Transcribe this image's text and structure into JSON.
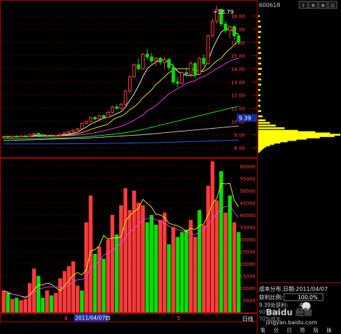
{
  "header": {
    "code": "600618"
  },
  "toolbar": [
    "⇧",
    "⊕",
    "⊗",
    "⊡"
  ],
  "price_axis": {
    "ticks": [
      "18.00",
      "17.00",
      "16.00",
      "15.00",
      "14.00",
      "13.00",
      "12.00",
      "11.00",
      "10.00",
      "9.00",
      "8.00"
    ],
    "current_price": "9.39",
    "high_label": "18.79"
  },
  "volume_axis": {
    "ticks": [
      "60000",
      "55000",
      "50000",
      "45000",
      "40000",
      "35000",
      "30000",
      "25000",
      "20000",
      "15000",
      "10000",
      "5000"
    ]
  },
  "date_axis": {
    "month_a": "4",
    "date_label": "2011/04/07四",
    "month_b": "5",
    "period": "日线"
  },
  "chip_panel": {
    "title": "成本分布,日期:",
    "date": "2011/04/07",
    "profit_label": "获利比例:",
    "profit_value": "100.0%",
    "line3": "9.39处获利:",
    "line3_value": "41%",
    "line4": "90%成本",
    "line5": "70%成本"
  },
  "bottom_tabs": [
    "笔",
    "分",
    "日",
    "势",
    "指",
    "操"
  ],
  "watermark": "Baidu 经验",
  "watermark_url": "jingyan.baidu.com",
  "colors": {
    "up": "#ff3b3b",
    "down": "#00e000",
    "ma5": "#ffffff",
    "ma10": "#ffff00",
    "ma20": "#ff40ff",
    "ma60": "#00ff00",
    "ma120": "#d0d0d0",
    "ma250": "#3060ff",
    "chips": "#ffff00",
    "grid": "#a00000"
  },
  "chart_data": {
    "type": "candlestick+volume",
    "candles": [
      [
        8.8,
        8.9,
        8.7,
        8.85
      ],
      [
        8.85,
        8.95,
        8.75,
        8.8
      ],
      [
        8.8,
        8.9,
        8.7,
        8.88
      ],
      [
        8.88,
        8.95,
        8.78,
        8.82
      ],
      [
        8.82,
        8.95,
        8.8,
        8.9
      ],
      [
        8.9,
        9.0,
        8.8,
        8.85
      ],
      [
        8.85,
        9.05,
        8.85,
        9.0
      ],
      [
        9.0,
        9.15,
        8.95,
        9.1
      ],
      [
        9.1,
        9.15,
        8.95,
        9.0
      ],
      [
        9.0,
        9.05,
        8.85,
        8.9
      ],
      [
        8.9,
        9.0,
        8.8,
        8.95
      ],
      [
        8.95,
        9.05,
        8.85,
        8.88
      ],
      [
        8.88,
        9.0,
        8.8,
        8.95
      ],
      [
        8.95,
        9.1,
        8.9,
        9.05
      ],
      [
        9.05,
        9.2,
        9.0,
        9.15
      ],
      [
        9.15,
        9.3,
        9.1,
        9.25
      ],
      [
        9.25,
        9.4,
        9.2,
        9.35
      ],
      [
        9.35,
        9.5,
        9.3,
        9.45
      ],
      [
        9.45,
        9.9,
        9.4,
        9.85
      ],
      [
        9.85,
        10.1,
        9.8,
        10.0
      ],
      [
        10.0,
        10.4,
        9.95,
        10.3
      ],
      [
        10.3,
        10.4,
        10.1,
        10.2
      ],
      [
        10.2,
        10.5,
        10.1,
        10.45
      ],
      [
        10.45,
        10.5,
        10.2,
        10.3
      ],
      [
        10.3,
        10.8,
        10.25,
        10.7
      ],
      [
        10.7,
        11.2,
        10.6,
        11.1
      ],
      [
        11.1,
        11.3,
        10.9,
        11.0
      ],
      [
        11.0,
        11.4,
        10.9,
        11.3
      ],
      [
        11.3,
        12.4,
        11.2,
        12.3
      ],
      [
        12.3,
        13.5,
        12.2,
        13.4
      ],
      [
        13.4,
        14.4,
        13.3,
        14.3
      ],
      [
        14.3,
        14.8,
        13.9,
        14.0
      ],
      [
        14.0,
        15.2,
        13.9,
        15.1
      ],
      [
        15.1,
        15.5,
        14.7,
        14.9
      ],
      [
        14.9,
        15.2,
        14.4,
        14.6
      ],
      [
        14.6,
        14.9,
        14.2,
        14.8
      ],
      [
        14.8,
        14.9,
        14.3,
        14.5
      ],
      [
        14.5,
        14.9,
        14.0,
        14.7
      ],
      [
        14.7,
        14.8,
        13.9,
        14.1
      ],
      [
        14.1,
        14.4,
        12.8,
        13.0
      ],
      [
        13.0,
        13.4,
        12.6,
        12.9
      ],
      [
        12.9,
        13.8,
        12.8,
        13.7
      ],
      [
        13.7,
        14.1,
        13.4,
        13.6
      ],
      [
        13.6,
        14.6,
        13.3,
        14.4
      ],
      [
        14.4,
        14.5,
        13.3,
        13.6
      ],
      [
        13.6,
        14.9,
        13.5,
        14.8
      ],
      [
        14.8,
        15.1,
        14.2,
        14.4
      ],
      [
        14.4,
        16.6,
        14.3,
        16.5
      ],
      [
        16.5,
        17.8,
        16.4,
        17.6
      ],
      [
        17.6,
        18.79,
        17.4,
        18.5
      ],
      [
        18.5,
        18.6,
        17.2,
        17.4
      ],
      [
        17.4,
        17.6,
        16.7,
        16.9
      ],
      [
        16.9,
        17.3,
        16.3,
        17.2
      ],
      [
        17.2,
        17.3,
        16.2,
        16.5
      ],
      [
        16.5,
        16.6,
        15.8,
        16.0
      ]
    ],
    "volume": [
      [
        9000,
        "up"
      ],
      [
        8000,
        "down"
      ],
      [
        5500,
        "up"
      ],
      [
        6000,
        "down"
      ],
      [
        5000,
        "up"
      ],
      [
        5500,
        "up"
      ],
      [
        12000,
        "up"
      ],
      [
        18000,
        "up"
      ],
      [
        15000,
        "down"
      ],
      [
        6000,
        "down"
      ],
      [
        9000,
        "up"
      ],
      [
        7000,
        "down"
      ],
      [
        8000,
        "up"
      ],
      [
        14000,
        "up"
      ],
      [
        17000,
        "up"
      ],
      [
        19000,
        "up"
      ],
      [
        21000,
        "up"
      ],
      [
        11000,
        "up"
      ],
      [
        9000,
        "down"
      ],
      [
        37000,
        "up"
      ],
      [
        48000,
        "up"
      ],
      [
        24000,
        "down"
      ],
      [
        27000,
        "up"
      ],
      [
        22000,
        "down"
      ],
      [
        30000,
        "up"
      ],
      [
        40000,
        "up"
      ],
      [
        32000,
        "down"
      ],
      [
        44000,
        "up"
      ],
      [
        51000,
        "up"
      ],
      [
        42000,
        "up"
      ],
      [
        50000,
        "up"
      ],
      [
        45000,
        "up"
      ],
      [
        44000,
        "up"
      ],
      [
        37000,
        "down"
      ],
      [
        40000,
        "down"
      ],
      [
        36000,
        "down"
      ],
      [
        38000,
        "up"
      ],
      [
        41000,
        "up"
      ],
      [
        28000,
        "down"
      ],
      [
        35000,
        "up"
      ],
      [
        31000,
        "down"
      ],
      [
        33000,
        "down"
      ],
      [
        34000,
        "down"
      ],
      [
        38000,
        "up"
      ],
      [
        31000,
        "up"
      ],
      [
        42000,
        "down"
      ],
      [
        36000,
        "up"
      ],
      [
        52000,
        "up"
      ],
      [
        62000,
        "up"
      ],
      [
        46000,
        "up"
      ],
      [
        58000,
        "down"
      ],
      [
        41000,
        "up"
      ],
      [
        48000,
        "down"
      ],
      [
        37000,
        "up"
      ],
      [
        33000,
        "down"
      ]
    ],
    "ma_price": {
      "ma5": [
        8.85,
        8.84,
        8.85,
        8.86,
        8.86,
        8.85,
        8.87,
        8.93,
        8.98,
        8.97,
        8.95,
        8.94,
        8.93,
        8.96,
        8.99,
        9.05,
        9.13,
        9.2,
        9.39,
        9.58,
        9.8,
        9.96,
        10.1,
        10.25,
        10.32,
        10.45,
        10.6,
        10.75,
        11.1,
        11.6,
        12.1,
        12.7,
        13.4,
        14.0,
        14.3,
        14.5,
        14.7,
        14.6,
        14.5,
        14.2,
        13.8,
        13.6,
        13.5,
        13.5,
        13.5,
        13.6,
        14.0,
        14.6,
        15.5,
        16.2,
        16.8,
        17.0,
        17.0,
        16.8,
        16.6
      ],
      "ma10": [
        8.86,
        8.86,
        8.86,
        8.86,
        8.86,
        8.86,
        8.86,
        8.88,
        8.9,
        8.92,
        8.92,
        8.92,
        8.92,
        8.93,
        8.95,
        8.98,
        9.03,
        9.08,
        9.17,
        9.27,
        9.4,
        9.5,
        9.6,
        9.7,
        9.8,
        10.1,
        10.3,
        10.4,
        10.6,
        10.9,
        11.1,
        11.4,
        11.8,
        12.1,
        12.4,
        12.8,
        13.1,
        13.4,
        13.7,
        13.9,
        14.0,
        14.0,
        14.0,
        14.0,
        13.9,
        13.8,
        13.8,
        14.0,
        14.3,
        14.6,
        14.8,
        15.2,
        15.5,
        15.8,
        16.1
      ],
      "ma20": [
        8.86,
        8.86,
        8.86,
        8.86,
        8.86,
        8.86,
        8.86,
        8.86,
        8.86,
        8.86,
        8.87,
        8.88,
        8.89,
        8.9,
        8.92,
        8.93,
        8.95,
        8.97,
        9.0,
        9.05,
        9.1,
        9.15,
        9.22,
        9.3,
        9.38,
        9.46,
        9.55,
        9.65,
        9.78,
        9.93,
        10.1,
        10.3,
        10.5,
        10.8,
        11.0,
        11.2,
        11.5,
        11.8,
        12.1,
        12.3,
        12.5,
        12.7,
        12.9,
        13.0,
        13.1,
        13.3,
        13.4,
        13.6,
        13.8,
        14.0,
        14.2,
        14.4,
        14.6,
        14.7,
        14.8
      ],
      "ma60": [
        8.7,
        8.7,
        8.7,
        8.7,
        8.7,
        8.7,
        8.71,
        8.71,
        8.72,
        8.72,
        8.73,
        8.73,
        8.74,
        8.75,
        8.76,
        8.77,
        8.78,
        8.8,
        8.82,
        8.84,
        8.87,
        8.9,
        8.93,
        8.96,
        9.0,
        9.03,
        9.07,
        9.11,
        9.16,
        9.21,
        9.27,
        9.33,
        9.4,
        9.48,
        9.56,
        9.64,
        9.72,
        9.8,
        9.88,
        9.96,
        10.04,
        10.12,
        10.2,
        10.28,
        10.36,
        10.44,
        10.52,
        10.6,
        10.68,
        10.76,
        10.84,
        10.92,
        11.0,
        11.08,
        11.16
      ],
      "ma120": [
        8.55,
        8.56,
        8.57,
        8.58,
        8.59,
        8.6,
        8.61,
        8.62,
        8.63,
        8.64,
        8.65,
        8.66,
        8.67,
        8.68,
        8.69,
        8.7,
        8.71,
        8.72,
        8.73,
        8.74,
        8.76,
        8.78,
        8.8,
        8.82,
        8.84,
        8.86,
        8.88,
        8.9,
        8.92,
        8.94,
        8.96,
        8.98,
        9.0,
        9.03,
        9.06,
        9.09,
        9.12,
        9.15,
        9.18,
        9.21,
        9.24,
        9.27,
        9.3,
        9.33,
        9.36,
        9.39,
        9.42,
        9.45,
        9.48,
        9.51,
        9.54,
        9.57,
        9.6,
        9.63,
        9.66
      ],
      "ma250": [
        8.3,
        8.3,
        8.3,
        8.3,
        8.3,
        8.3,
        8.3,
        8.3,
        8.3,
        8.3,
        8.31,
        8.31,
        8.31,
        8.31,
        8.31,
        8.32,
        8.32,
        8.32,
        8.32,
        8.33,
        8.33,
        8.33,
        8.34,
        8.34,
        8.34,
        8.35,
        8.35,
        8.36,
        8.36,
        8.37,
        8.37,
        8.38,
        8.38,
        8.39,
        8.39,
        8.4,
        8.41,
        8.42,
        8.43,
        8.44,
        8.45,
        8.46,
        8.47,
        8.48,
        8.49,
        8.5,
        8.51,
        8.52,
        8.53,
        8.54,
        8.55,
        8.56,
        8.57,
        8.58,
        8.6
      ]
    },
    "ma_volume": {
      "vma5": [
        9000,
        8000,
        7500,
        7200,
        6700,
        6000,
        7200,
        9300,
        11300,
        11300,
        12000,
        11600,
        10200,
        8800,
        11000,
        13000,
        15400,
        16400,
        15400,
        17400,
        25200,
        25800,
        27400,
        31600,
        30200,
        30600,
        30600,
        31000,
        37400,
        39800,
        41400,
        42800,
        46400,
        44800,
        43200,
        40400,
        40000,
        39000,
        36600,
        36000,
        35600,
        34600,
        33200,
        34600,
        34000,
        35600,
        36400,
        40000,
        44800,
        46800,
        53000,
        52800,
        53000,
        46000,
        43400
      ],
      "vma10": [
        9000,
        8500,
        7500,
        7100,
        6700,
        6500,
        7000,
        8000,
        9500,
        10000,
        10500,
        10500,
        10500,
        10200,
        10500,
        11200,
        12500,
        13500,
        13500,
        14500,
        18500,
        19500,
        21000,
        23500,
        24500,
        25500,
        27000,
        28500,
        31000,
        33000,
        34500,
        36000,
        38000,
        38500,
        39000,
        38000,
        37500,
        36500,
        35500,
        34500,
        34000,
        33500,
        33000,
        32500,
        32000,
        33000,
        34000,
        36000,
        38500,
        40500,
        42500,
        43500,
        44000,
        41000,
        39000
      ]
    },
    "chip_distribution": [
      [
        18.0,
        2
      ],
      [
        17.6,
        3
      ],
      [
        17.2,
        4
      ],
      [
        16.8,
        4
      ],
      [
        16.4,
        3
      ],
      [
        16.0,
        3
      ],
      [
        15.6,
        3
      ],
      [
        15.2,
        4
      ],
      [
        14.8,
        4
      ],
      [
        14.4,
        4
      ],
      [
        14.0,
        5
      ],
      [
        13.6,
        4
      ],
      [
        13.2,
        4
      ],
      [
        12.8,
        4
      ],
      [
        12.4,
        3
      ],
      [
        12.0,
        3
      ],
      [
        11.6,
        3
      ],
      [
        11.2,
        3
      ],
      [
        10.8,
        4
      ],
      [
        10.4,
        6
      ],
      [
        10.1,
        10
      ],
      [
        9.9,
        16
      ],
      [
        9.7,
        24
      ],
      [
        9.5,
        36
      ],
      [
        9.3,
        54
      ],
      [
        9.2,
        78
      ],
      [
        9.1,
        98
      ],
      [
        9.0,
        112
      ],
      [
        8.9,
        104
      ],
      [
        8.8,
        84
      ],
      [
        8.7,
        66
      ],
      [
        8.6,
        52
      ],
      [
        8.5,
        40
      ],
      [
        8.4,
        30
      ],
      [
        8.3,
        22
      ],
      [
        8.2,
        16
      ],
      [
        8.1,
        11
      ],
      [
        8.0,
        8
      ],
      [
        7.9,
        6
      ],
      [
        7.8,
        4
      ],
      [
        7.7,
        2
      ]
    ],
    "price_range": [
      7.5,
      18.9
    ],
    "volume_range": [
      0,
      62000
    ]
  }
}
